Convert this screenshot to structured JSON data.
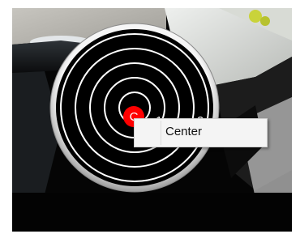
{
  "scope": {
    "marker_color": "#ff0000",
    "ring_color": "#ffffff",
    "dial_color": "#000000",
    "bezel_color": "#d9d9d9",
    "center_label": "C",
    "ring_labels": [
      "1",
      "2"
    ]
  },
  "context_menu": {
    "items": [
      {
        "label": "Center"
      }
    ]
  }
}
